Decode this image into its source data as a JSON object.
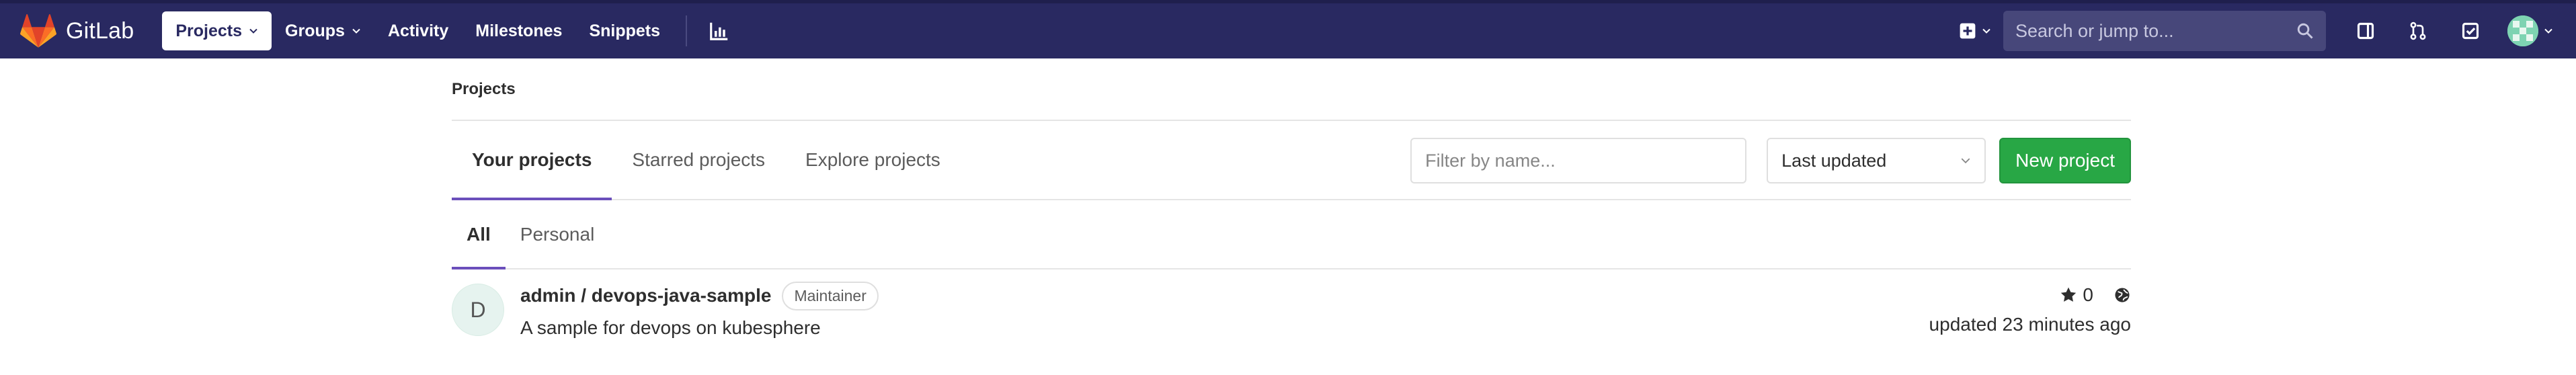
{
  "navbar": {
    "brand_name": "GitLab",
    "links": [
      {
        "label": "Projects",
        "active": true,
        "dropdown": true
      },
      {
        "label": "Groups",
        "active": false,
        "dropdown": true
      },
      {
        "label": "Activity",
        "active": false,
        "dropdown": false
      },
      {
        "label": "Milestones",
        "active": false,
        "dropdown": false
      },
      {
        "label": "Snippets",
        "active": false,
        "dropdown": false
      }
    ],
    "search_placeholder": "Search or jump to...",
    "icons": [
      "chart-icon",
      "plus-square-icon",
      "search-icon",
      "sidebar-icon",
      "merge-request-icon",
      "todo-check-icon",
      "user-avatar"
    ]
  },
  "breadcrumb": "Projects",
  "tabs": [
    {
      "label": "Your projects",
      "active": true
    },
    {
      "label": "Starred projects",
      "active": false
    },
    {
      "label": "Explore projects",
      "active": false
    }
  ],
  "filter": {
    "placeholder": "Filter by name...",
    "value": ""
  },
  "sort": {
    "selected": "Last updated"
  },
  "new_project_label": "New project",
  "subtabs": [
    {
      "label": "All",
      "active": true
    },
    {
      "label": "Personal",
      "active": false
    }
  ],
  "projects": [
    {
      "avatar_letter": "D",
      "name": "admin / devops-java-sample",
      "role": "Maintainer",
      "description": "A sample for devops on kubesphere",
      "stars": "0",
      "visibility_icon": "globe-icon",
      "updated": "updated 23 minutes ago"
    }
  ],
  "colors": {
    "navbar_bg": "#292961",
    "accent": "#6b4fbb",
    "primary_button": "#28a745",
    "logo_orange": "#fc6d26"
  }
}
